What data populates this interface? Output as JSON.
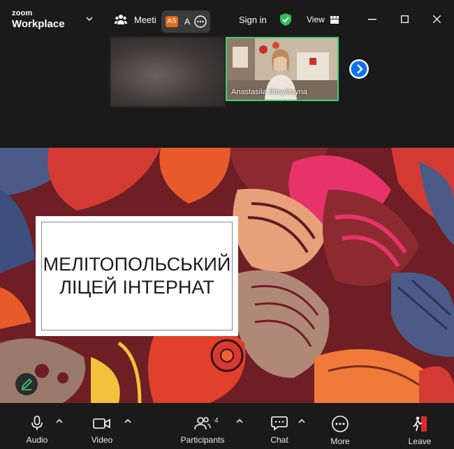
{
  "app": {
    "logo_line1": "zoom",
    "logo_line2": "Workplace"
  },
  "header": {
    "meeting_label": "Meeti",
    "participant_initials": "AS",
    "participant_initial_2": "A",
    "sign_in": "Sign in",
    "view_label": "View"
  },
  "video": {
    "speaker_name": "Anastasiia Sitsylitsyna"
  },
  "slide": {
    "title_line1": "МЕЛІТОПОЛЬСЬКИЙ",
    "title_line2": "ЛІЦЕЙ ІНТЕРНАТ"
  },
  "toolbar": {
    "audio": "Audio",
    "video": "Video",
    "participants": "Participants",
    "participants_count": "4",
    "chat": "Chat",
    "more": "More",
    "leave": "Leave"
  },
  "colors": {
    "accent_green": "#3ad27a",
    "next_blue": "#0e72ed",
    "leave_red": "#e02828",
    "avatar_orange": "#e06b1a"
  }
}
